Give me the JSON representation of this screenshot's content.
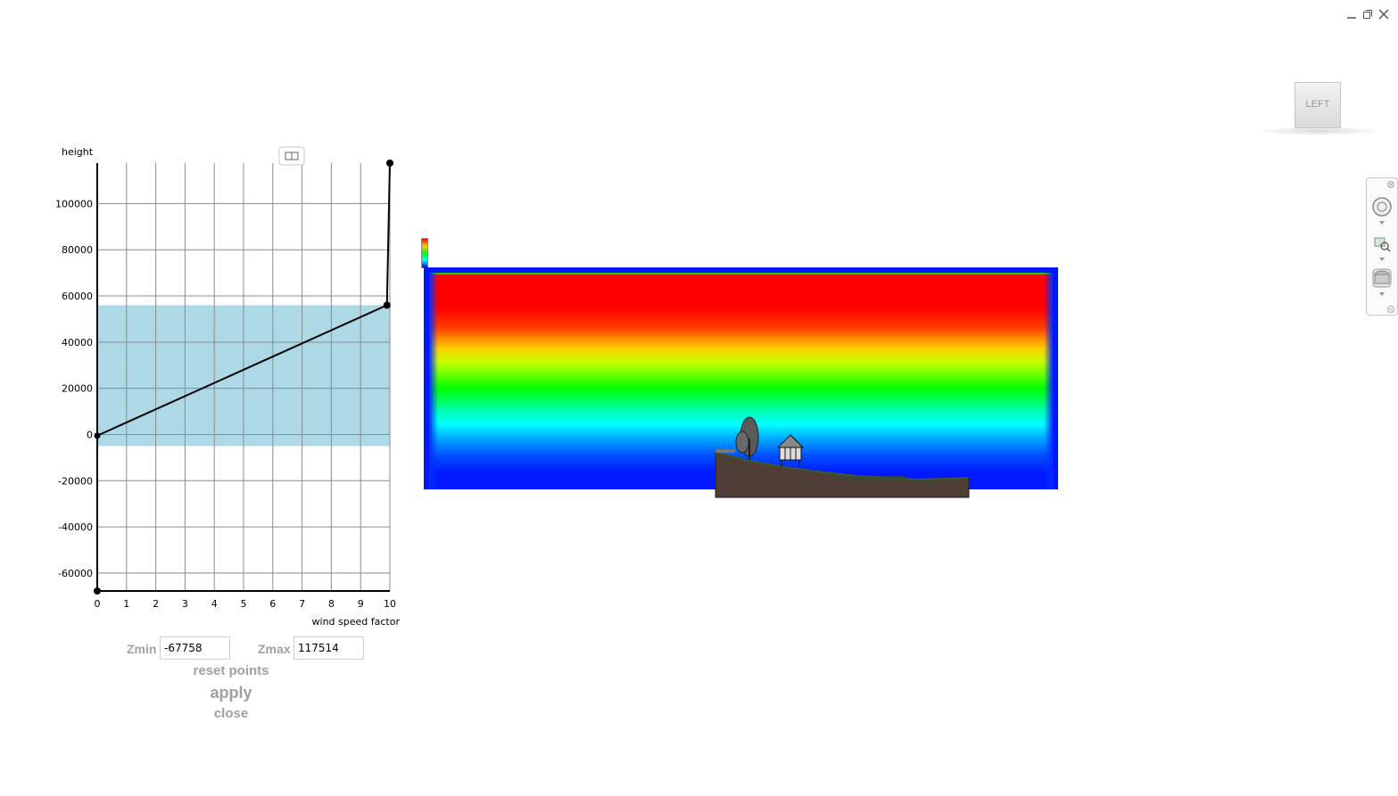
{
  "chart_data": {
    "type": "line",
    "title": "",
    "xlabel": "wind speed factor",
    "ylabel": "height",
    "xlim": [
      0,
      10
    ],
    "ylim": [
      -67758,
      117514
    ],
    "x_ticks": [
      0,
      1,
      2,
      3,
      4,
      5,
      6,
      7,
      8,
      9,
      10
    ],
    "y_ticks": [
      -60000,
      -40000,
      -20000,
      0,
      20000,
      40000,
      60000,
      80000,
      100000
    ],
    "grid": true,
    "legend": "none",
    "series": [
      {
        "x": [
          0,
          0,
          9.9,
          10
        ],
        "y": [
          -67758,
          -500,
          56000,
          117514
        ]
      }
    ],
    "highlight_band": [
      -5000,
      56000
    ],
    "line_color": "#000000",
    "band_color": "#add8e6"
  },
  "controls": {
    "zmin_label": "Zmin",
    "zmin_value": "-67758",
    "zmax_label": "Zmax",
    "zmax_value": "117514",
    "reset_label": "reset points",
    "apply_label": "apply",
    "close_label": "close"
  },
  "viewcube": {
    "face": "LEFT"
  },
  "icons": {
    "minimize": "minimize-icon",
    "restore": "restore-icon",
    "close": "close-icon",
    "chart_toggle": "panel-toggle-icon",
    "steering_wheel": "steering-wheel-icon",
    "zoom": "zoom-icon",
    "orbit": "orbit-icon"
  },
  "colors": {
    "heat_high": "#ff0000",
    "heat_low": "#0018ff",
    "terrain": "#4e3e36"
  }
}
